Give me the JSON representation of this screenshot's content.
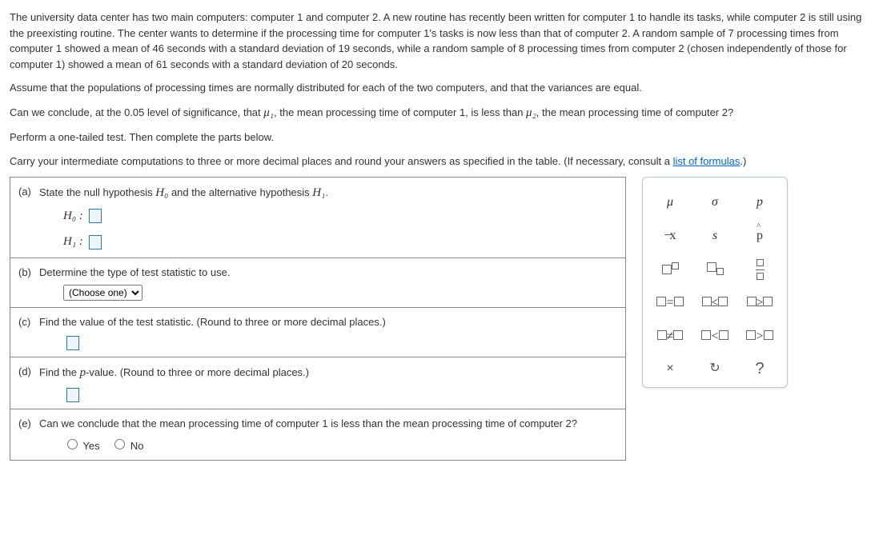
{
  "intro": {
    "p1": "The university data center has two main computers: computer 1 and computer 2. A new routine has recently been written for computer 1 to handle its tasks, while computer 2 is still using the preexisting routine. The center wants to determine if the processing time for computer 1's tasks is now less than that of computer 2. A random sample of 7 processing times from computer 1 showed a mean of 46 seconds with a standard deviation of 19 seconds, while a random sample of 8 processing times from computer 2 (chosen independently of those for computer 1) showed a mean of 61 seconds with a standard deviation of 20 seconds.",
    "p2": "Assume that the populations of processing times are normally distributed for each of the two computers, and that the variances are equal.",
    "p3_pre": "Can we conclude, at the 0.05 level of significance, that ",
    "p3_mu1": "μ₁",
    "p3_mid": ", the mean processing time of computer 1, is less than ",
    "p3_mu2": "μ₂",
    "p3_post": ", the mean processing time of computer 2?",
    "p4": "Perform a one-tailed test. Then complete the parts below.",
    "p5_pre": "Carry your intermediate computations to three or more decimal places and round your answers as specified in the table. (If necessary, consult a ",
    "p5_link": "list of formulas",
    "p5_post": ".)"
  },
  "parts": {
    "a": {
      "letter": "(a)",
      "text_pre": "State the null hypothesis ",
      "h0": "H₀",
      "text_mid": " and the alternative hypothesis ",
      "h1": "H₁",
      "text_post": ".",
      "h0_label": "H₀  :",
      "h1_label": "H₁  :"
    },
    "b": {
      "letter": "(b)",
      "text": "Determine the type of test statistic to use.",
      "choose": "(Choose one)"
    },
    "c": {
      "letter": "(c)",
      "text": "Find the value of the test statistic. (Round to three or more decimal places.)"
    },
    "d": {
      "letter": "(d)",
      "text_pre": "Find the ",
      "pval": "p",
      "text_post": "-value. (Round to three or more decimal places.)"
    },
    "e": {
      "letter": "(e)",
      "text": "Can we conclude that the mean processing time of computer 1 is less than the mean processing time of computer 2?",
      "yes": "Yes",
      "no": "No"
    }
  },
  "palette": {
    "r1": [
      "μ",
      "σ",
      "p"
    ],
    "r2": [
      "x̄",
      "s",
      "p̂"
    ],
    "help": "?"
  }
}
